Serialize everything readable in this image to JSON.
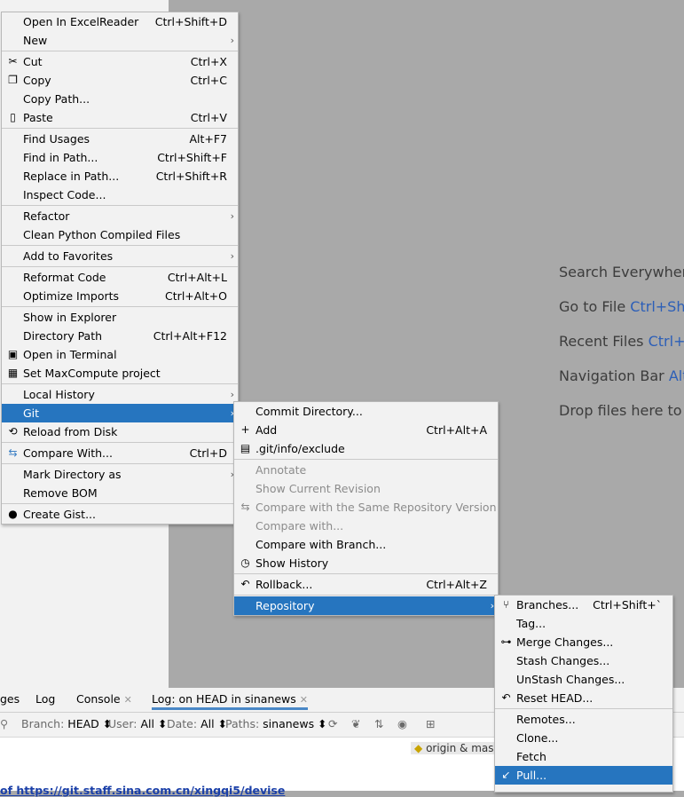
{
  "editor_hints": {
    "search": "Search Everywhere",
    "goto_file": "Go to File",
    "goto_file_key": "Ctrl+Shi",
    "recent_files": "Recent Files",
    "recent_files_key": "Ctrl+E",
    "nav_bar": "Navigation Bar",
    "nav_bar_key": "Alt",
    "drop_files": "Drop files here to o"
  },
  "context_menu": {
    "open_excel": {
      "label": "Open In ExcelReader",
      "shortcut": "Ctrl+Shift+D"
    },
    "new": {
      "label": "New"
    },
    "cut": {
      "label": "Cut",
      "shortcut": "Ctrl+X"
    },
    "copy": {
      "label": "Copy",
      "shortcut": "Ctrl+C"
    },
    "copy_path": {
      "label": "Copy Path..."
    },
    "paste": {
      "label": "Paste",
      "shortcut": "Ctrl+V"
    },
    "find_usages": {
      "label": "Find Usages",
      "shortcut": "Alt+F7"
    },
    "find_in_path": {
      "label": "Find in Path...",
      "shortcut": "Ctrl+Shift+F"
    },
    "replace_in_path": {
      "label": "Replace in Path...",
      "shortcut": "Ctrl+Shift+R"
    },
    "inspect_code": {
      "label": "Inspect Code..."
    },
    "refactor": {
      "label": "Refactor"
    },
    "clean_python": {
      "label": "Clean Python Compiled Files"
    },
    "add_favorites": {
      "label": "Add to Favorites"
    },
    "reformat_code": {
      "label": "Reformat Code",
      "shortcut": "Ctrl+Alt+L"
    },
    "optimize_imports": {
      "label": "Optimize Imports",
      "shortcut": "Ctrl+Alt+O"
    },
    "show_explorer": {
      "label": "Show in Explorer"
    },
    "directory_path": {
      "label": "Directory Path",
      "shortcut": "Ctrl+Alt+F12"
    },
    "open_terminal": {
      "label": "Open in Terminal"
    },
    "maxcompute": {
      "label": "Set MaxCompute project"
    },
    "local_history": {
      "label": "Local History"
    },
    "git": {
      "label": "Git"
    },
    "reload_disk": {
      "label": "Reload from Disk"
    },
    "compare_with": {
      "label": "Compare With...",
      "shortcut": "Ctrl+D"
    },
    "mark_directory": {
      "label": "Mark Directory as"
    },
    "remove_bom": {
      "label": "Remove BOM"
    },
    "create_gist": {
      "label": "Create Gist..."
    }
  },
  "git_menu": {
    "commit_dir": {
      "label": "Commit Directory..."
    },
    "add": {
      "label": "Add",
      "shortcut": "Ctrl+Alt+A"
    },
    "exclude": {
      "label": ".git/info/exclude"
    },
    "annotate": {
      "label": "Annotate"
    },
    "show_revision": {
      "label": "Show Current Revision"
    },
    "compare_same_repo": {
      "label": "Compare with the Same Repository Version"
    },
    "compare_with": {
      "label": "Compare with..."
    },
    "compare_branch": {
      "label": "Compare with Branch..."
    },
    "show_history": {
      "label": "Show History"
    },
    "rollback": {
      "label": "Rollback...",
      "shortcut": "Ctrl+Alt+Z"
    },
    "repository": {
      "label": "Repository"
    }
  },
  "repo_menu": {
    "branches": {
      "label": "Branches...",
      "shortcut": "Ctrl+Shift+`"
    },
    "tag": {
      "label": "Tag..."
    },
    "merge": {
      "label": "Merge Changes..."
    },
    "stash": {
      "label": "Stash Changes..."
    },
    "unstash": {
      "label": "UnStash Changes..."
    },
    "reset_head": {
      "label": "Reset HEAD..."
    },
    "remotes": {
      "label": "Remotes..."
    },
    "clone": {
      "label": "Clone..."
    },
    "fetch": {
      "label": "Fetch"
    },
    "pull": {
      "label": "Pull..."
    }
  },
  "bottom_panel": {
    "tabs": [
      "ges",
      "Log",
      "Console",
      "Log: on HEAD in sinanews"
    ],
    "branch": {
      "label": "Branch:",
      "value": "HEAD"
    },
    "user": {
      "label": "User:",
      "value": "All"
    },
    "date": {
      "label": "Date:",
      "value": "All"
    },
    "paths": {
      "label": "Paths:",
      "value": "sinanews"
    },
    "tag_label": "origin & mas",
    "link_text": "of https://git.staff.sina.com.cn/xingqi5/devise"
  }
}
